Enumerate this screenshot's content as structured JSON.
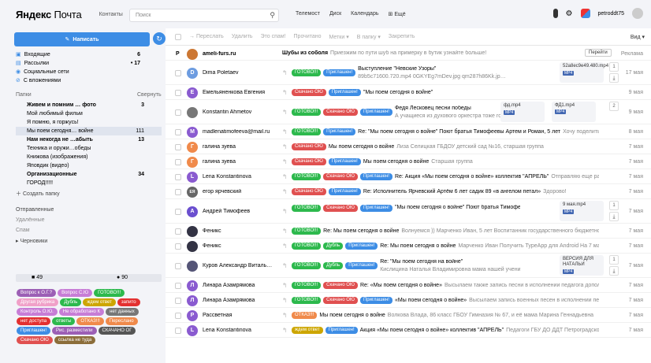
{
  "header": {
    "logo_bold": "Яндекс",
    "logo_thin": "Почта",
    "contacts": "Контакты",
    "search_placeholder": "Поиск",
    "nav": [
      "Телемост",
      "Диск",
      "Календарь",
      "Ещё"
    ],
    "username": "petroddt75"
  },
  "sidebar": {
    "compose": "Написать",
    "folders": [
      {
        "label": "Входящие",
        "count": "6"
      },
      {
        "label": "Рассылки",
        "count": "• 17"
      },
      {
        "label": "Социальные сети",
        "count": ""
      },
      {
        "label": "С вложениями",
        "count": ""
      }
    ],
    "papki_label": "Папки",
    "collapse_label": "Свернуть",
    "subfolders": [
      {
        "label": "Живем и помним … фото",
        "count": "3",
        "bold": true
      },
      {
        "label": "Мой любимый фильм",
        "count": "",
        "bold": false
      },
      {
        "label": "Я помню, я горжусь!",
        "count": "",
        "bold": false
      },
      {
        "label": "Мы поем сегодня… войне",
        "count": "111",
        "bold": false
      },
      {
        "label": "Нам некогда не …абыть",
        "count": "13",
        "bold": true
      },
      {
        "label": "Техника и оружи…обеды",
        "count": "",
        "bold": false
      },
      {
        "label": "Книжова (изображения)",
        "count": "",
        "bold": false
      },
      {
        "label": "Яповдик (видео)",
        "count": "",
        "bold": false
      },
      {
        "label": "Организационные",
        "count": "34",
        "bold": true
      },
      {
        "label": "ГОРОД!!!!!",
        "count": "",
        "bold": false
      }
    ],
    "create_folder": "Создать папку",
    "other_folders": [
      "Отправленные",
      "Удалённые",
      "Спам",
      "▸ Черновики"
    ],
    "stats": {
      "left": "49",
      "right": "90"
    },
    "tags": [
      {
        "label": "Вопрос к О.Г.?",
        "color": "#9c5fb5"
      },
      {
        "label": "Вопрос С.Ю",
        "color": "#c77dd6"
      },
      {
        "label": "ГОТОВО!!!",
        "color": "#2db94d"
      },
      {
        "label": "Другая рубрика",
        "color": "#f0a0c8"
      },
      {
        "label": "Дубль",
        "color": "#2db94d"
      },
      {
        "label": "ждем ответ",
        "color": "#cda600"
      },
      {
        "label": "запито",
        "color": "#e33030"
      },
      {
        "label": "Контроль О.Ю.",
        "color": "#c77dd6"
      },
      {
        "label": "Не обработано К",
        "color": "#c77dd6"
      },
      {
        "label": "нет данных",
        "color": "#777"
      },
      {
        "label": "нет доступа",
        "color": "#e33030"
      },
      {
        "label": "ответы",
        "color": "#2db94d"
      },
      {
        "label": "ОТКАЗ!!!",
        "color": "#f08a4b"
      },
      {
        "label": "Переслано",
        "color": "#f08a4b"
      },
      {
        "label": "Приглашен!",
        "color": "#3d8de5"
      },
      {
        "label": "Рис. разместили",
        "color": "#9c5fb5"
      },
      {
        "label": "СКАЧАНО ОГ",
        "color": "#555"
      },
      {
        "label": "Скачано ОЮ",
        "color": "#e05050"
      },
      {
        "label": "ссылка не тудa",
        "color": "#8b6d3a"
      }
    ]
  },
  "toolbar": {
    "items": [
      "→ Переслать",
      "Удалить",
      "Это спам!",
      "Прочитано",
      "Метки ▾",
      "В папку ▾",
      "Закрепить"
    ],
    "view": "Вид ▾"
  },
  "emails": [
    {
      "sender": "ameli-furs.ru",
      "subject": "Шубы из соболя",
      "preview": "Приезжим по пути шуб на примерку в бутик узнайте больше!",
      "date": "Реклама",
      "tags": [],
      "avatar": "",
      "avcolor": "#c73",
      "ad": true
    },
    {
      "sender": "Dima Poletaev",
      "subject": "Выступление \"Невские Узоры\"",
      "preview": "89b5c71600.720.mp4 0GKYEg7mDev.jpg qm287h86Kk.jp…",
      "date": "17 мая",
      "tags": [
        {
          "label": "ГОТОВО!!!",
          "color": "#2db94d"
        },
        {
          "label": "Приглашен!",
          "color": "#3d8de5"
        }
      ],
      "avatar": "D",
      "avcolor": "#6d9ce0",
      "att": "52a8ec9e49.480.mp4"
    },
    {
      "sender": "Емельяненкова Евгения",
      "subject": "\"Мы поем сегодня о войне\"",
      "preview": "",
      "date": "9 мая",
      "tags": [
        {
          "label": "Скачано ОЮ",
          "color": "#e05050"
        },
        {
          "label": "Приглашен!",
          "color": "#3d8de5"
        }
      ],
      "avatar": "Е",
      "avcolor": "#8a5bd0"
    },
    {
      "sender": "Konstantin Ahmetov",
      "subject": "Федя Лесковец песни победы",
      "preview": "А учащиеся из духового оркестра тоже го…",
      "date": "9 мая",
      "tags": [
        {
          "label": "ГОТОВО!!!",
          "color": "#2db94d"
        },
        {
          "label": "Скачано ОЮ",
          "color": "#e05050"
        },
        {
          "label": "Приглашен!",
          "color": "#3d8de5"
        }
      ],
      "avatar": "",
      "avcolor": "#777",
      "att": "фд.mp4",
      "att2": "ФД1.mp4"
    },
    {
      "sender": "madlenatimofeeva@mail.ru",
      "subject": "Re: \"Мы поем сегодня о войне\" Поют братья Тимофеевы Артем и Роман, 5 лет",
      "preview": "Хочу поделиться нашим…",
      "date": "8 мая",
      "tags": [
        {
          "label": "ГОТОВО!!!",
          "color": "#2db94d"
        },
        {
          "label": "Приглашен!",
          "color": "#3d8de5"
        }
      ],
      "avatar": "M",
      "avcolor": "#8a5bd0"
    },
    {
      "sender": "галина зуева",
      "subject": "Мы поем сегодня о войне",
      "preview": "Лиза Селицкая ГБДОУ детский сад №16, старшая группа",
      "date": "7 мая",
      "tags": [
        {
          "label": "Скачано ОЮ",
          "color": "#e05050"
        }
      ],
      "avatar": "Г",
      "avcolor": "#f08a4b"
    },
    {
      "sender": "галина зуева",
      "subject": "Мы поем сегодня о войне",
      "preview": "Старшая группа",
      "date": "7 мая",
      "tags": [
        {
          "label": "Скачано ОЮ",
          "color": "#e05050"
        },
        {
          "label": "Приглашен!",
          "color": "#3d8de5"
        }
      ],
      "avatar": "Г",
      "avcolor": "#f08a4b"
    },
    {
      "sender": "Lena Konstantinova",
      "subject": "Re: Акция «Мы поем сегодня о войне» коллектив \"АПРЕЛЬ\"",
      "preview": "Отправляю еще раз ссылки без логотипа…",
      "date": "7 мая",
      "tags": [
        {
          "label": "ГОТОВО!!!",
          "color": "#2db94d"
        },
        {
          "label": "Скачано ОЮ",
          "color": "#e05050"
        },
        {
          "label": "Приглашен!",
          "color": "#3d8de5"
        }
      ],
      "avatar": "L",
      "avcolor": "#8a5bd0"
    },
    {
      "sender": "егор ярчевский",
      "subject": "Re: Исполнитель Ярчевский Артём 6 лет садик 89 «в ангелом петал»",
      "preview": "Здорово!",
      "date": "7 мая",
      "tags": [
        {
          "label": "Скачано ОЮ",
          "color": "#e05050"
        },
        {
          "label": "Приглашен!",
          "color": "#3d8de5"
        }
      ],
      "avatar": "ЕЯ",
      "avcolor": "#666"
    },
    {
      "sender": "Андрей Тимофеев",
      "subject": "\"Мы поем сегодня о войне\" Поют братья Тимофеевы Артем и…",
      "preview": "",
      "date": "7 мая",
      "tags": [
        {
          "label": "ГОТОВО!!!",
          "color": "#2db94d"
        },
        {
          "label": "Скачано ОЮ",
          "color": "#e05050"
        },
        {
          "label": "Приглашен!",
          "color": "#3d8de5"
        }
      ],
      "avatar": "А",
      "avcolor": "#6b4fcf",
      "att": "9 мая.mp4"
    },
    {
      "sender": "Феникс",
      "subject": "Re: Мы поем сегодня о войне",
      "preview": "Волнуемся )) Марченко Иван, 5 лет Воспитанник государственного бюджетного дошколь…",
      "date": "7 мая",
      "tags": [
        {
          "label": "ГОТОВО!!!",
          "color": "#2db94d"
        }
      ],
      "avatar": "",
      "avcolor": "#334"
    },
    {
      "sender": "Феникс",
      "subject": "Re: Мы поем сегодня о войне",
      "preview": "Марченко Иван Получить TypeApp для Android На 7 мая 2020 г…",
      "date": "7 мая",
      "tags": [
        {
          "label": "ГОТОВО!!!",
          "color": "#2db94d"
        },
        {
          "label": "Дубль",
          "color": "#2db94d"
        },
        {
          "label": "Приглашен!",
          "color": "#3d8de5"
        }
      ],
      "avatar": "",
      "avcolor": "#334"
    },
    {
      "sender": "Куров Александр Витальевич",
      "subject": "Re: \"Мы поем сегодня на войне\"",
      "preview": "Кислицина Наталья Владимировна мама нашей ученицы из школы …",
      "date": "7 мая",
      "tags": [
        {
          "label": "ГОТОВО!!!",
          "color": "#2db94d"
        },
        {
          "label": "Дубль",
          "color": "#2db94d"
        },
        {
          "label": "Приглашен!",
          "color": "#3d8de5"
        }
      ],
      "avatar": "",
      "avcolor": "#557",
      "att": "ВЕРСИЯ ДЛЯ НАТАЛЬИ"
    },
    {
      "sender": "Линара Азамрямова",
      "subject": "Re: «Мы поем сегодня о войне»",
      "preview": "Высылаем также запись песни в исполнении педагога дополнительно…",
      "date": "7 мая",
      "tags": [
        {
          "label": "ГОТОВО!!!",
          "color": "#2db94d"
        },
        {
          "label": "Скачано ОЮ",
          "color": "#e05050"
        }
      ],
      "avatar": "Л",
      "avcolor": "#8a5bd0"
    },
    {
      "sender": "Линара Азамрямова",
      "subject": "«Мы поем сегодня о войне»",
      "preview": "Высылаем запись военных песен в исполнении педагога…",
      "date": "7 мая",
      "tags": [
        {
          "label": "ГОТОВО!!!",
          "color": "#2db94d"
        },
        {
          "label": "Скачано ОЮ",
          "color": "#e05050"
        },
        {
          "label": "Приглашен!",
          "color": "#3d8de5"
        }
      ],
      "avatar": "Л",
      "avcolor": "#8a5bd0"
    },
    {
      "sender": "Рассветная",
      "subject": "Мы поем сегодня о войне",
      "preview": "Волкова Влада, 86 класс ГБОУ Гимназия № 67, и её мама Марина Геннадьевна",
      "date": "7 мая",
      "tags": [
        {
          "label": "ОТКАЗ!!!",
          "color": "#f08a4b"
        }
      ],
      "avatar": "Р",
      "avcolor": "#8a5bd0"
    },
    {
      "sender": "Lena Konstantinova",
      "subject": "Акция «Мы поем сегодня о войне» коллектив \"АПРЕЛЬ\"",
      "preview": "Педагоги ГБУ ДО ДДТ Петроградского района…",
      "date": "7 мая",
      "tags": [
        {
          "label": "ждем ответ",
          "color": "#cda600"
        },
        {
          "label": "Приглашен!",
          "color": "#3d8de5"
        }
      ],
      "avatar": "L",
      "avcolor": "#8a5bd0"
    }
  ]
}
